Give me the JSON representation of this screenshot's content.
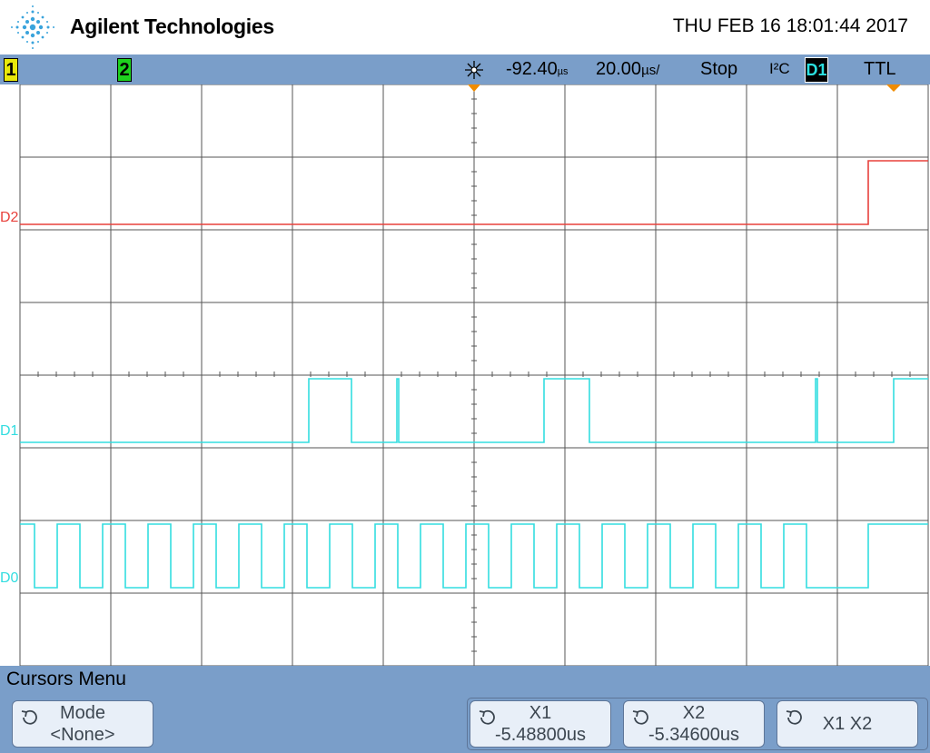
{
  "header": {
    "brand": "Agilent Technologies",
    "datetime": "THU FEB 16 18:01:44 2017"
  },
  "status": {
    "ch1": "1",
    "ch2": "2",
    "delay": "-92.40",
    "delay_unit": "µs",
    "timebase": "20.00",
    "timebase_unit": "µs/",
    "run_state": "Stop",
    "trigger_type": "I²C",
    "trigger_source": "D1",
    "threshold": "TTL"
  },
  "channels": {
    "d2": "D2",
    "d1": "D1",
    "d0": "D0"
  },
  "colors": {
    "d2": "#e8413c",
    "d1": "#33dde0",
    "d0": "#33dde0",
    "grid": "#555555",
    "status_bar": "#7a9ec9",
    "trigger_marker": "#f08c00"
  },
  "menu": {
    "title": "Cursors Menu",
    "mode_label": "Mode",
    "mode_value": "<None>",
    "x1_label": "X1",
    "x1_value": "-5.48800us",
    "x2_label": "X2",
    "x2_value": "-5.34600us",
    "x1x2_label": "X1 X2"
  }
}
